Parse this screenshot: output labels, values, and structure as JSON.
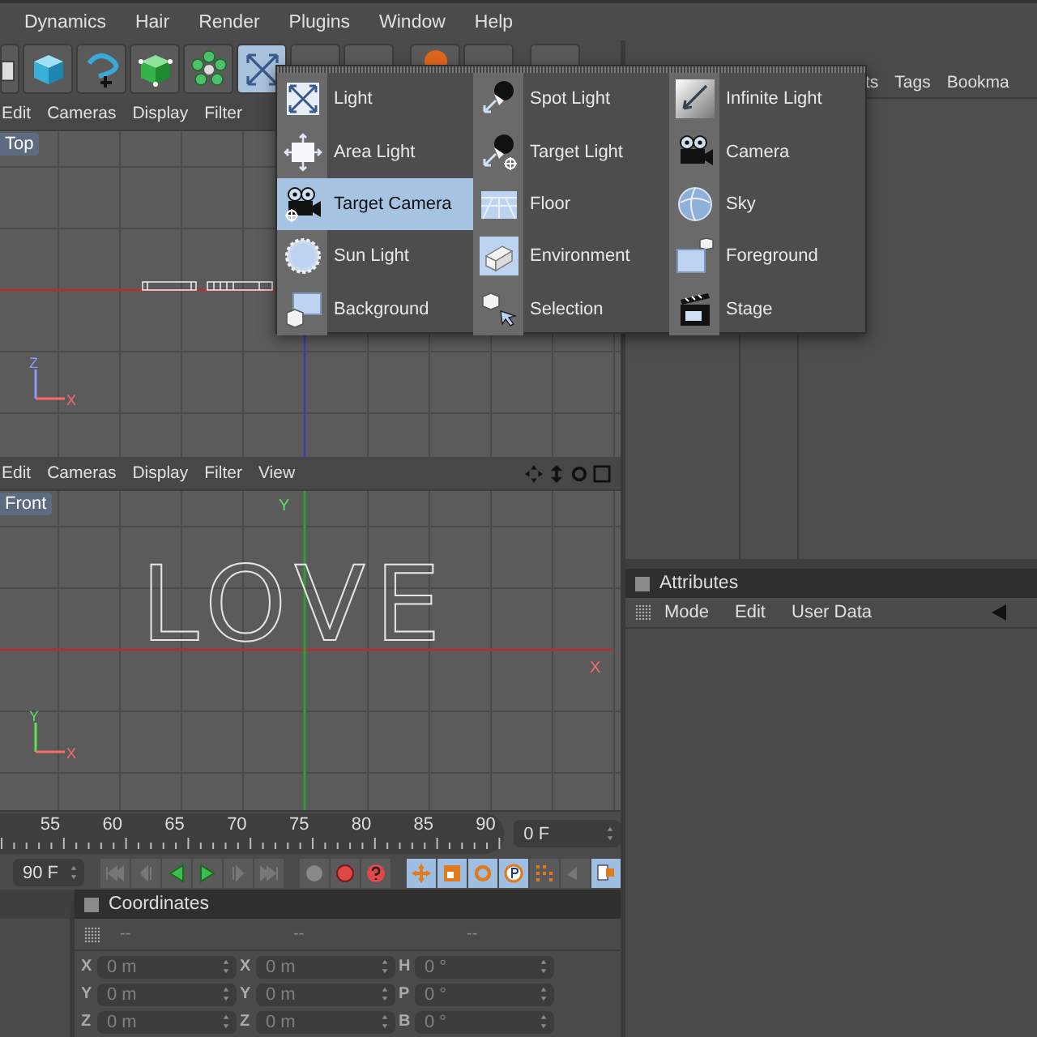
{
  "menu_bar": [
    "Dynamics",
    "Hair",
    "Render",
    "Plugins",
    "Window",
    "Help"
  ],
  "object_manager": {
    "tabs": [
      "ts",
      "Tags",
      "Bookma"
    ]
  },
  "viewports": [
    {
      "kind": "top",
      "label": "Top",
      "menu": [
        "Edit",
        "Cameras",
        "Display",
        "Filter"
      ],
      "gizmo": [
        "Z",
        "X"
      ]
    },
    {
      "kind": "front",
      "label": "Front",
      "menu": [
        "Edit",
        "Cameras",
        "Display",
        "Filter",
        "View"
      ],
      "gizmo": [
        "Y",
        "X"
      ],
      "world_axes": [
        "Y",
        "X"
      ],
      "scene_text": "LOVE"
    }
  ],
  "timeline": {
    "ticks": [
      "55",
      "60",
      "65",
      "70",
      "75",
      "80",
      "85",
      "90"
    ],
    "current_frame": "0 F"
  },
  "transport": {
    "end_frame": "90 F"
  },
  "add_menu": {
    "columns": [
      [
        {
          "label": "Light",
          "selected": false
        },
        {
          "label": "Area Light",
          "selected": false
        },
        {
          "label": "Target Camera",
          "selected": true
        },
        {
          "label": "Sun Light",
          "selected": false
        },
        {
          "label": "Background",
          "selected": false
        }
      ],
      [
        {
          "label": "Spot Light",
          "selected": false
        },
        {
          "label": "Target Light",
          "selected": false
        },
        {
          "label": "Floor",
          "selected": false
        },
        {
          "label": "Environment",
          "selected": false
        },
        {
          "label": "Selection",
          "selected": false
        }
      ],
      [
        {
          "label": "Infinite Light",
          "selected": false
        },
        {
          "label": "Camera",
          "selected": false
        },
        {
          "label": "Sky",
          "selected": false
        },
        {
          "label": "Foreground",
          "selected": false
        },
        {
          "label": "Stage",
          "selected": false
        }
      ]
    ]
  },
  "attributes": {
    "title": "Attributes",
    "menu": [
      "Mode",
      "Edit",
      "User Data"
    ]
  },
  "coordinates": {
    "title": "Coordinates",
    "headers": [
      "--",
      "--",
      "--"
    ],
    "rows": [
      [
        {
          "axis": "X",
          "value": "0 m"
        },
        {
          "axis": "X",
          "value": "0 m"
        },
        {
          "axis": "H",
          "value": "0 °"
        }
      ],
      [
        {
          "axis": "Y",
          "value": "0 m"
        },
        {
          "axis": "Y",
          "value": "0 m"
        },
        {
          "axis": "P",
          "value": "0 °"
        }
      ],
      [
        {
          "axis": "Z",
          "value": "0 m"
        },
        {
          "axis": "Z",
          "value": "0 m"
        },
        {
          "axis": "B",
          "value": "0 °"
        }
      ]
    ]
  }
}
